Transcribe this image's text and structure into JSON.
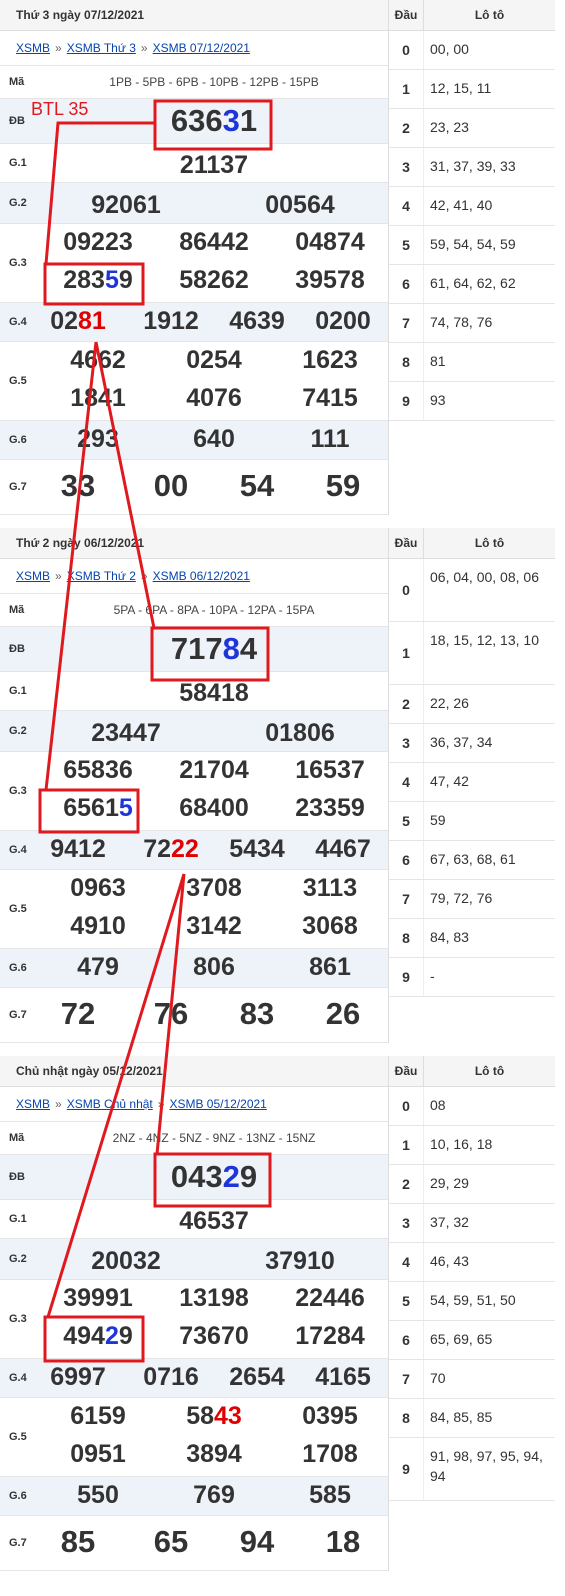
{
  "btl_label": "BTL 35",
  "days": [
    {
      "header": "Thứ 3 ngày 07/12/2021",
      "links": [
        "XSMB",
        "XSMB Thứ 3",
        "XSMB 07/12/2021"
      ],
      "ma_label": "Mã",
      "ma": "1PB - 5PB - 6PB - 10PB - 12PB - 15PB",
      "db_label": "ĐB",
      "db": {
        "head": "636",
        "hl": "3",
        "tail": "1"
      },
      "prizes": [
        {
          "label": "G.1",
          "values": [
            "21137"
          ]
        },
        {
          "label": "G.2",
          "values": [
            "92061",
            "00564"
          ]
        },
        {
          "label": "G.3",
          "values": [
            "09223",
            "86442",
            "04874",
            "28359",
            "58262",
            "39578"
          ]
        },
        {
          "label": "G.4",
          "values": [
            "0281",
            "1912",
            "4639",
            "0200"
          ]
        },
        {
          "label": "G.5",
          "values": [
            "4662",
            "0254",
            "1623",
            "1841",
            "4076",
            "7415"
          ]
        },
        {
          "label": "G.6",
          "values": [
            "293",
            "640",
            "111"
          ]
        },
        {
          "label": "G.7",
          "values": [
            "33",
            "00",
            "54",
            "59"
          ]
        }
      ],
      "loto_head": [
        "Đầu",
        "Lô tô"
      ],
      "loto": [
        {
          "d": "0",
          "l": "00, 00"
        },
        {
          "d": "1",
          "l": "12, 15, 11"
        },
        {
          "d": "2",
          "l": "23, 23"
        },
        {
          "d": "3",
          "l": "31, 37, 39, 33"
        },
        {
          "d": "4",
          "l": "42, 41, 40"
        },
        {
          "d": "5",
          "l": "59, 54, 54, 59"
        },
        {
          "d": "6",
          "l": "61, 64, 62, 62"
        },
        {
          "d": "7",
          "l": "74, 78, 76"
        },
        {
          "d": "8",
          "l": "81"
        },
        {
          "d": "9",
          "l": "93"
        }
      ]
    },
    {
      "header": "Thứ 2 ngày 06/12/2021",
      "links": [
        "XSMB",
        "XSMB Thứ 2",
        "XSMB 06/12/2021"
      ],
      "ma_label": "Mã",
      "ma": "5PA - 6PA - 8PA - 10PA - 12PA - 15PA",
      "db_label": "ĐB",
      "db": {
        "head": "717",
        "hl": "8",
        "tail": "4"
      },
      "prizes": [
        {
          "label": "G.1",
          "values": [
            "58418"
          ]
        },
        {
          "label": "G.2",
          "values": [
            "23447",
            "01806"
          ]
        },
        {
          "label": "G.3",
          "values": [
            "65836",
            "21704",
            "16537",
            "65615",
            "68400",
            "23359"
          ]
        },
        {
          "label": "G.4",
          "values": [
            "9412",
            "7222",
            "5434",
            "4467"
          ]
        },
        {
          "label": "G.5",
          "values": [
            "0963",
            "3708",
            "3113",
            "4910",
            "3142",
            "3068"
          ]
        },
        {
          "label": "G.6",
          "values": [
            "479",
            "806",
            "861"
          ]
        },
        {
          "label": "G.7",
          "values": [
            "72",
            "76",
            "83",
            "26"
          ]
        }
      ],
      "loto_head": [
        "Đầu",
        "Lô tô"
      ],
      "loto": [
        {
          "d": "0",
          "l": "06, 04, 00, 08, 06"
        },
        {
          "d": "1",
          "l": "18, 15, 12, 13, 10"
        },
        {
          "d": "2",
          "l": "22, 26"
        },
        {
          "d": "3",
          "l": "36, 37, 34"
        },
        {
          "d": "4",
          "l": "47, 42"
        },
        {
          "d": "5",
          "l": "59"
        },
        {
          "d": "6",
          "l": "67, 63, 68, 61"
        },
        {
          "d": "7",
          "l": "79, 72, 76"
        },
        {
          "d": "8",
          "l": "84, 83"
        },
        {
          "d": "9",
          "l": "-"
        }
      ]
    },
    {
      "header": "Chủ nhật ngày 05/12/2021",
      "links": [
        "XSMB",
        "XSMB Chủ nhật",
        "XSMB 05/12/2021"
      ],
      "ma_label": "Mã",
      "ma": "2NZ - 4NZ - 5NZ - 9NZ - 13NZ - 15NZ",
      "db_label": "ĐB",
      "db": {
        "head": "043",
        "hl": "2",
        "tail": "9"
      },
      "prizes": [
        {
          "label": "G.1",
          "values": [
            "46537"
          ]
        },
        {
          "label": "G.2",
          "values": [
            "20032",
            "37910"
          ]
        },
        {
          "label": "G.3",
          "values": [
            "39991",
            "13198",
            "22446",
            "49429",
            "73670",
            "17284"
          ]
        },
        {
          "label": "G.4",
          "values": [
            "6997",
            "0716",
            "2654",
            "4165"
          ]
        },
        {
          "label": "G.5",
          "values": [
            "6159",
            "5843",
            "0395",
            "0951",
            "3894",
            "1708"
          ]
        },
        {
          "label": "G.6",
          "values": [
            "550",
            "769",
            "585"
          ]
        },
        {
          "label": "G.7",
          "values": [
            "85",
            "65",
            "94",
            "18"
          ]
        }
      ],
      "loto_head": [
        "Đầu",
        "Lô tô"
      ],
      "loto": [
        {
          "d": "0",
          "l": "08"
        },
        {
          "d": "1",
          "l": "10, 16, 18"
        },
        {
          "d": "2",
          "l": "29, 29"
        },
        {
          "d": "3",
          "l": "37, 32"
        },
        {
          "d": "4",
          "l": "46, 43"
        },
        {
          "d": "5",
          "l": "54, 59, 51, 50"
        },
        {
          "d": "6",
          "l": "65, 69, 65"
        },
        {
          "d": "7",
          "l": "70"
        },
        {
          "d": "8",
          "l": "84, 85, 85"
        },
        {
          "d": "9",
          "l": "91, 98, 97, 95, 94, 94"
        }
      ]
    }
  ],
  "highlights": {
    "blue": "#1d35d9",
    "red": "#e00000",
    "annotation": "#e0191f"
  }
}
